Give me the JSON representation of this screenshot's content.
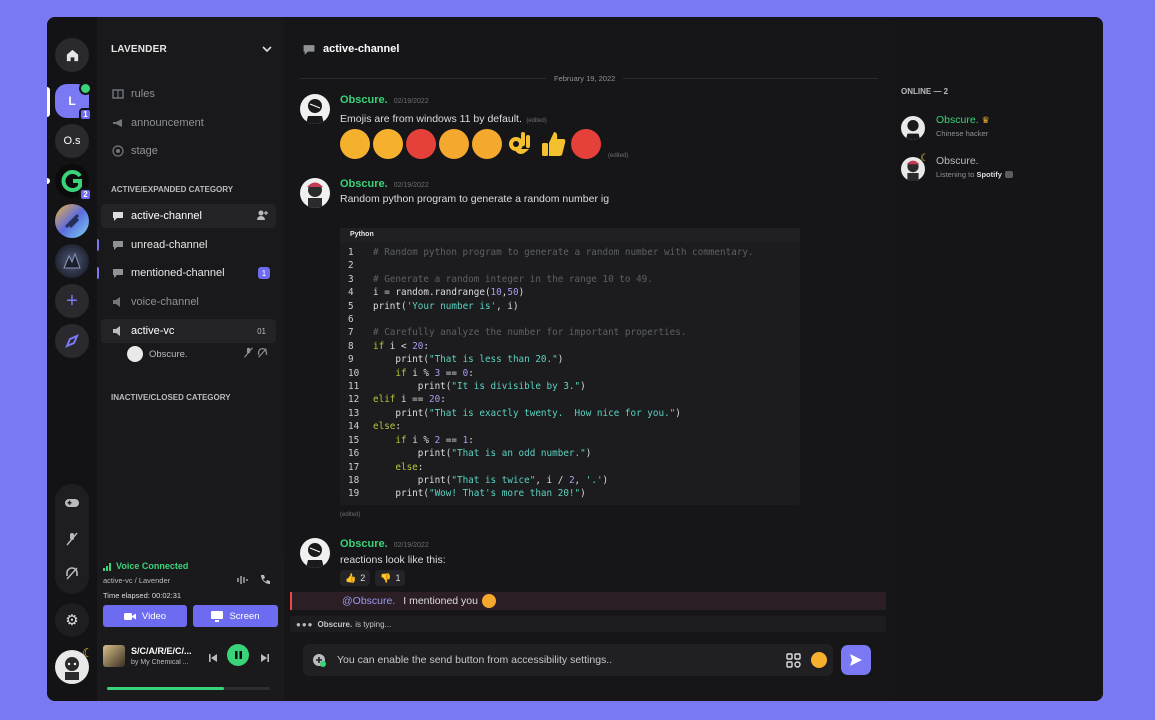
{
  "servers": {
    "home_tip": "Home",
    "selected": {
      "letter": "L",
      "badge": "1"
    },
    "server_os": {
      "label": "O.s"
    },
    "server_g": {
      "badge": "2"
    }
  },
  "sidebar": {
    "server_name": "LAVENDER",
    "channels_top": [
      {
        "name": "rules",
        "icon": "rules-icon"
      },
      {
        "name": "announcement",
        "icon": "megaphone-icon"
      },
      {
        "name": "stage",
        "icon": "stage-icon"
      }
    ],
    "category_active": "ACTIVE/EXPANDED CATEGORY",
    "active_channel": "active-channel",
    "unread_channel": "unread-channel",
    "mentioned_channel": "mentioned-channel",
    "mentioned_badge": "1",
    "voice_channel": "voice-channel",
    "active_vc": "active-vc",
    "active_vc_count": "01",
    "vc_member": "Obscure.",
    "category_inactive": "INACTIVE/CLOSED CATEGORY"
  },
  "voice": {
    "status": "Voice Connected",
    "location": "active-vc / Lavender",
    "elapsed": "Time elapsed: 00:02:31",
    "video_label": "Video",
    "screen_label": "Screen"
  },
  "player": {
    "title": "S/C/A/R/E/C/...",
    "artist": "by My Chemical ...",
    "progress": 0.72
  },
  "chat": {
    "channel_title": "active-channel",
    "date_divider": "February 19, 2022",
    "messages": [
      {
        "author": "Obscure.",
        "time": "02/19/2022",
        "text": "Emojis are from windows 11 by default.",
        "edited": "(edited)"
      },
      {
        "author": "Obscure.",
        "time": "02/19/2022",
        "text": "Random python program to generate a random number ig"
      },
      {
        "author": "Obscure.",
        "time": "02/19/2022",
        "text": "reactions look like this:"
      }
    ],
    "emoji_row_edited": "(edited)",
    "code_lang": "Python",
    "code_edited": "(edited)",
    "reactions": [
      {
        "emoji": "thumbs-up",
        "count": "2"
      },
      {
        "emoji": "thumbs-down",
        "count": "1"
      }
    ],
    "mention": {
      "tag": "@Obscure.",
      "text": "I mentioned you"
    },
    "typing": {
      "user": "Obscure.",
      "text": "is typing..."
    },
    "input_placeholder": "You can enable the send button from accessibility settings.."
  },
  "members": {
    "header": "ONLINE — 2",
    "list": [
      {
        "name": "Obscure.",
        "status": "Chinese hacker",
        "color": "#3ad37a"
      },
      {
        "name": "Obscure.",
        "status_prefix": "Listening to ",
        "status_bold": "Spotify",
        "color": "#b9bbbe"
      }
    ]
  },
  "colors": {
    "accent": "#7a79f3",
    "online": "#3ad37a",
    "mention": "#f04747"
  }
}
